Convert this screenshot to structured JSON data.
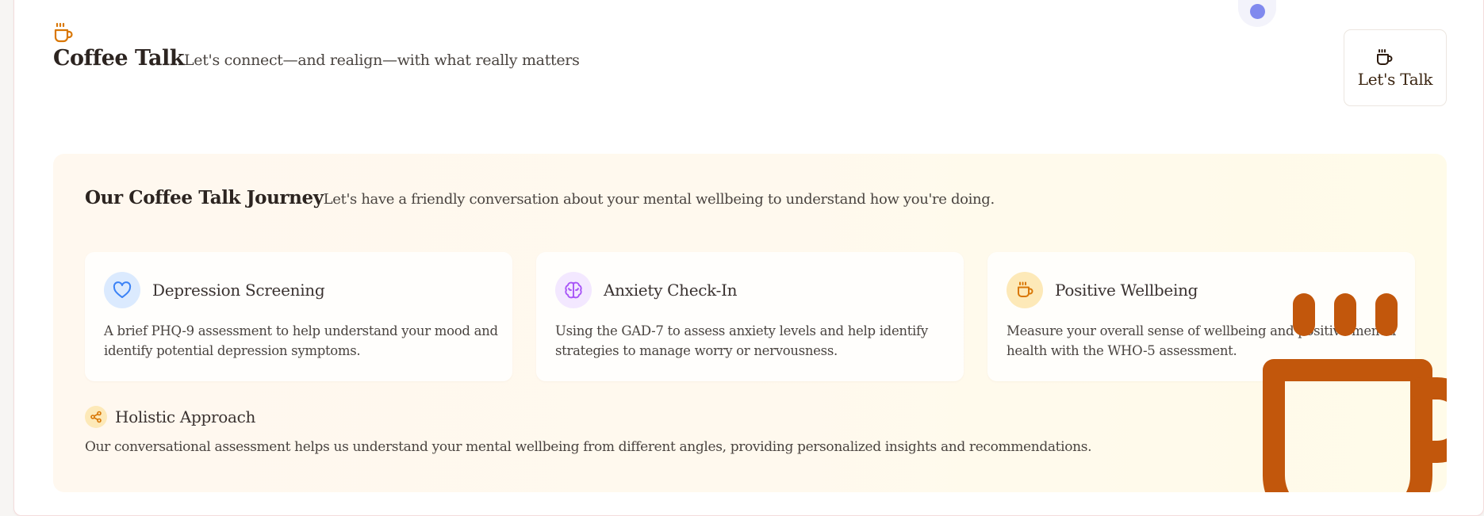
{
  "header": {
    "brand_title": "Coffee Talk",
    "brand_subtitle": "Let's connect—and realign—with what really matters",
    "brand_icon": "coffee-cup-icon",
    "talk_button_label": "Let's Talk",
    "talk_button_icon": "coffee-cup-icon"
  },
  "journey": {
    "title": "Our Coffee Talk Journey",
    "description": "Let's have a friendly conversation about your mental wellbeing to understand how you're doing.",
    "cards": [
      {
        "icon": "heart-icon",
        "title": "Depression Screening",
        "description": "A brief PHQ-9 assessment to help understand your mood and identify potential depression symptoms."
      },
      {
        "icon": "brain-icon",
        "title": "Anxiety Check-In",
        "description": "Using the GAD-7 to assess anxiety levels and help identify strategies to manage worry or nervousness."
      },
      {
        "icon": "coffee-cup-icon",
        "title": "Positive Wellbeing",
        "description": "Measure your overall sense of wellbeing and positive mental health with the WHO-5 assessment."
      }
    ],
    "holistic": {
      "icon": "share-nodes-icon",
      "title": "Holistic Approach",
      "description": "Our conversational assessment helps us understand your mental wellbeing from different angles, providing personalized insights and recommendations."
    }
  },
  "colors": {
    "accent_orange": "#c2570c",
    "brand_orange": "#d97706",
    "heart_blue": "#3b82f6",
    "brain_purple": "#a855f7",
    "dot_indigo": "#8089ee"
  }
}
